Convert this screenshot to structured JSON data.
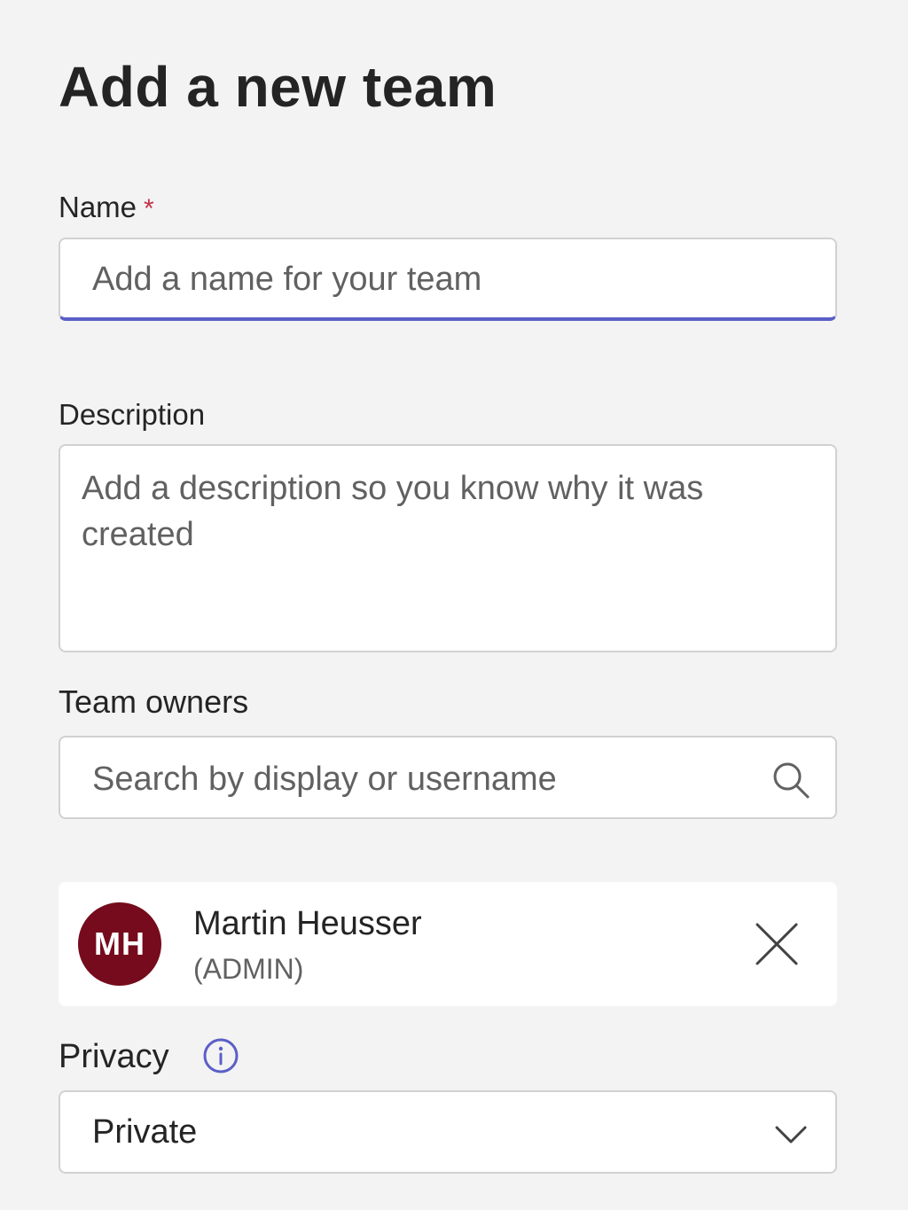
{
  "title": "Add a new team",
  "name_field": {
    "label": "Name",
    "required_marker": "*",
    "placeholder": "Add a name for your team",
    "value": ""
  },
  "description_field": {
    "label": "Description",
    "placeholder": "Add a description so you know why it was created",
    "value": ""
  },
  "team_owners": {
    "label": "Team owners",
    "search_placeholder": "Search by display or username",
    "search_icon": "search-icon",
    "owners": [
      {
        "initials": "MH",
        "name": "Martin Heusser",
        "role": "(ADMIN)",
        "avatar_color": "#750b1c",
        "remove_icon": "close-icon"
      }
    ]
  },
  "privacy": {
    "label": "Privacy",
    "info_icon": "info-icon",
    "selected": "Private",
    "dropdown_icon": "chevron-down-icon"
  },
  "colors": {
    "accent": "#5b5fc7",
    "required": "#c4314b",
    "background": "#f3f3f3"
  }
}
